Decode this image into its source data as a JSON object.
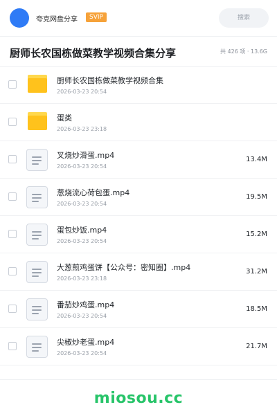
{
  "header": {
    "brand": "夸克网盘分享",
    "badge": "SVIP",
    "search_placeholder": "搜索"
  },
  "share": {
    "title": "厨师长农国栋做菜教学视频合集分享",
    "meta": "共 426 项 · 13.6G"
  },
  "files": [
    {
      "type": "folder",
      "icon": "folder-icon",
      "name": "厨师长农国栋做菜教学视频合集",
      "date": "2026-03-23 20:54",
      "size": ""
    },
    {
      "type": "folder",
      "icon": "folder-icon",
      "name": "蛋类",
      "date": "2026-03-23 23:18",
      "size": ""
    },
    {
      "type": "file",
      "icon": "document-icon",
      "name": "叉烧炒滑蛋.mp4",
      "date": "2026-03-23 20:54",
      "size": "13.4M"
    },
    {
      "type": "file",
      "icon": "document-icon",
      "name": "葱烧流心荷包蛋.mp4",
      "date": "2026-03-23 20:54",
      "size": "19.5M"
    },
    {
      "type": "file",
      "icon": "document-icon",
      "name": "蛋包炒饭.mp4",
      "date": "2026-03-23 20:54",
      "size": "15.2M"
    },
    {
      "type": "file",
      "icon": "document-icon",
      "name": "大葱煎鸡蛋饼【公众号：密知圈】.mp4",
      "date": "2026-03-23 23:18",
      "size": "31.2M"
    },
    {
      "type": "file",
      "icon": "document-icon",
      "name": "番茄炒鸡蛋.mp4",
      "date": "2026-03-23 20:54",
      "size": "18.5M"
    },
    {
      "type": "file",
      "icon": "document-icon",
      "name": "尖椒炒老蛋.mp4",
      "date": "2026-03-23 20:54",
      "size": "21.7M"
    }
  ],
  "footer": {
    "watermark": "miosou.cc"
  },
  "colors": {
    "accent_blue": "#2f7bf6",
    "badge_orange": "#f6a23a",
    "folder_yellow": "#ffc21c",
    "watermark_green": "#27c469"
  }
}
